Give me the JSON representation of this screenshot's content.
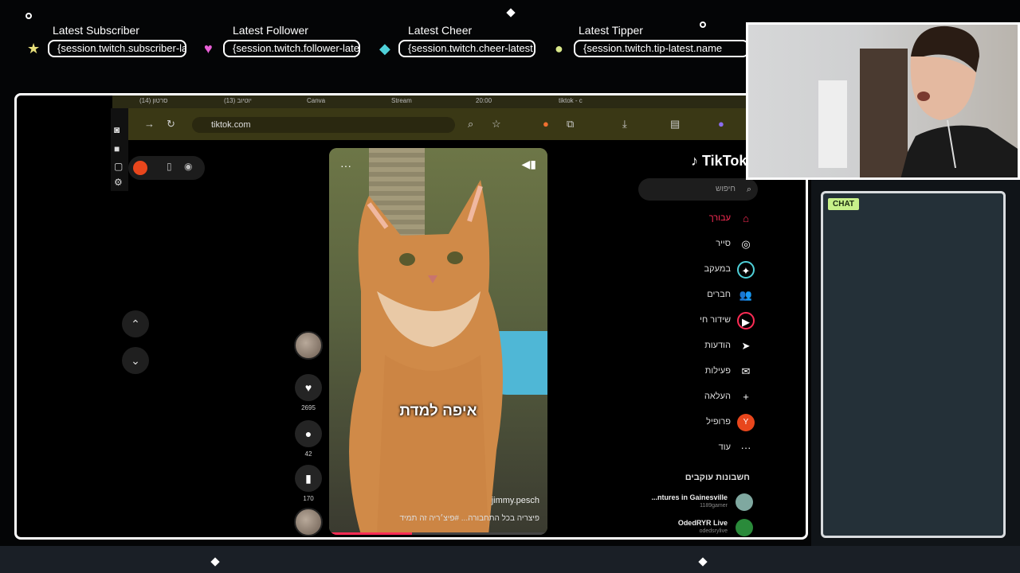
{
  "alerts": [
    {
      "title": "Latest Subscriber",
      "value": "{session.twitch.subscriber-latest",
      "icon": "★",
      "icon_color": "#e8e07a"
    },
    {
      "title": "Latest Follower",
      "value": "{session.twitch.follower-latest",
      "icon": "♥",
      "icon_color": "#e85fd6"
    },
    {
      "title": "Latest Cheer",
      "value": "{session.twitch.cheer-latest",
      "icon": "◆",
      "icon_color": "#4fd1d9"
    },
    {
      "title": "Latest Tipper",
      "value": "{session.twitch.tip-latest.name",
      "icon": "●",
      "icon_color": "#d9e88a"
    }
  ],
  "browser": {
    "url": "tiktok.com",
    "tabs": [
      "(14) סרטון",
      "(13) יוטיוב",
      "Canva",
      "Stream",
      "20:00",
      "tiktok - c"
    ]
  },
  "video": {
    "caption": "איפה למדת",
    "author": "jimmy.pesch",
    "description": "פיצריה בכל התחבורה... #פיצ׳ריה זה תמיד",
    "progress": 0.38
  },
  "actions": {
    "likes": "2695",
    "comments": "42",
    "saves": "170"
  },
  "tiktok": {
    "logo": "TikTok",
    "search_placeholder": "חיפוש",
    "nav": [
      {
        "label": "עבורך",
        "icon": "home-icon",
        "glyph": "⌂",
        "active": true
      },
      {
        "label": "סייר",
        "icon": "compass-icon",
        "glyph": "◎",
        "active": false
      },
      {
        "label": "במעקב",
        "icon": "following-icon",
        "glyph": "✦",
        "active": false
      },
      {
        "label": "חברים",
        "icon": "friends-icon",
        "glyph": "👥",
        "active": false
      },
      {
        "label": "שידור חי",
        "icon": "live-icon",
        "glyph": "▶",
        "active": false
      },
      {
        "label": "הודעות",
        "icon": "messages-icon",
        "glyph": "➤",
        "active": false
      },
      {
        "label": "פעילות",
        "icon": "activity-icon",
        "glyph": "✉",
        "active": false
      },
      {
        "label": "העלאה",
        "icon": "upload-icon",
        "glyph": "+",
        "active": false
      },
      {
        "label": "פרופיל",
        "icon": "profile-icon",
        "glyph": "Y",
        "active": false
      },
      {
        "label": "עוד",
        "icon": "more-icon",
        "glyph": "···",
        "active": false
      }
    ],
    "following_title": "חשבונות עוקבים",
    "following": [
      {
        "name": "...ntures in Gainesville",
        "sub": "1189gamer"
      },
      {
        "name": "OdedRYR Live",
        "sub": "odedsrylive"
      }
    ]
  },
  "chat": {
    "tag": "CHAT"
  },
  "colors": {
    "accent": "#fe2c55",
    "chat_bg": "#243038",
    "chat_tag": "#c7f08a"
  }
}
